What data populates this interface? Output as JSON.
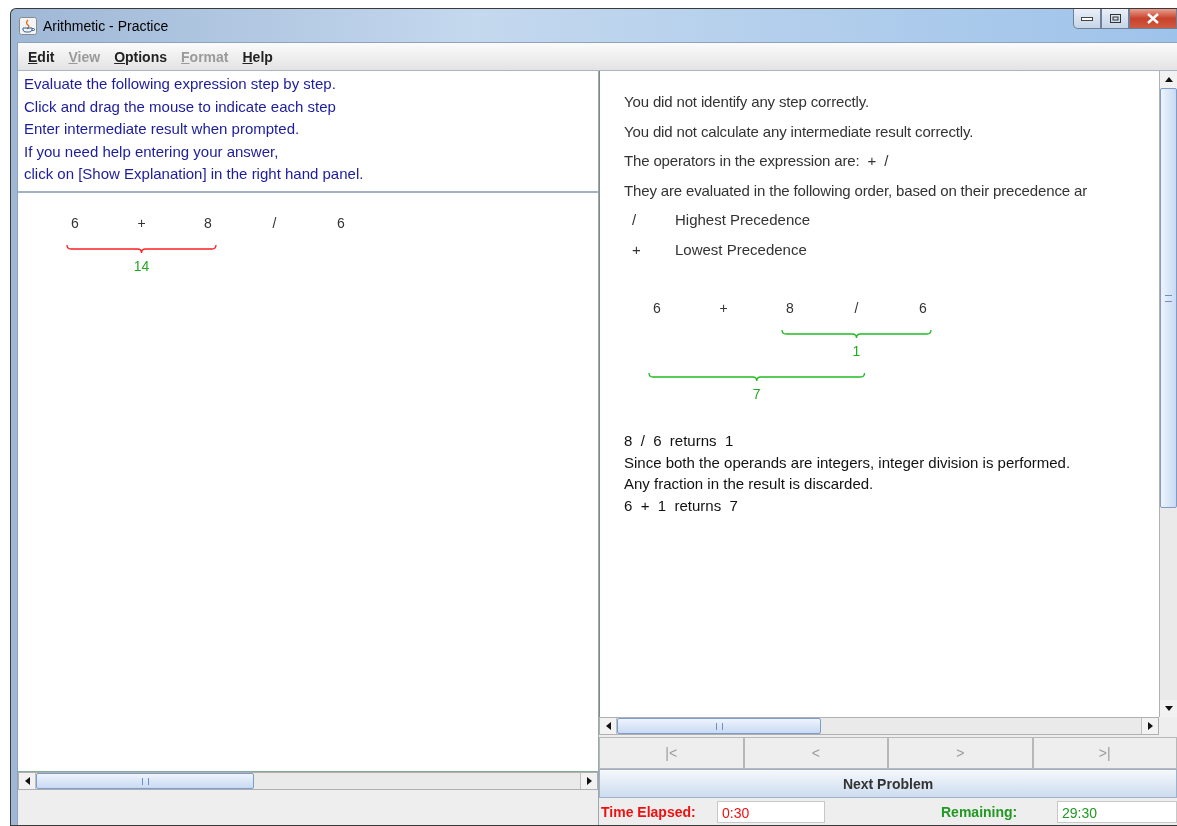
{
  "window": {
    "title": "Arithmetic - Practice"
  },
  "menu": [
    {
      "label": "Edit",
      "disabled": false
    },
    {
      "label": "View",
      "disabled": true
    },
    {
      "label": "Options",
      "disabled": false
    },
    {
      "label": "Format",
      "disabled": true
    },
    {
      "label": "Help",
      "disabled": false
    }
  ],
  "instructions": [
    "Evaluate the following expression step by step.",
    "Click and drag the mouse to indicate each step",
    "Enter intermediate result when prompted.",
    "If you need help entering your answer,",
    "click on [Show Explanation] in the right hand panel."
  ],
  "left_expression": {
    "children": [
      {
        "result": "14",
        "correct": false,
        "children": [
          {
            "token": "6"
          },
          {
            "token": "+"
          },
          {
            "token": "8"
          }
        ]
      },
      {
        "token": "/"
      },
      {
        "token": "6"
      }
    ]
  },
  "explanation": {
    "summary": [
      "You did not identify any step correctly.",
      "You did not calculate any intermediate result correctly.",
      "The operators in the expression are:  +  /",
      "They are evaluated in the following order, based on their precedence ar"
    ],
    "precedence": [
      {
        "operator": "/",
        "label": "Highest Precedence"
      },
      {
        "operator": "+",
        "label": "Lowest Precedence"
      }
    ],
    "expression": {
      "result": "7",
      "correct": true,
      "children": [
        {
          "token": "6"
        },
        {
          "token": "+"
        },
        {
          "result": "1",
          "correct": true,
          "children": [
            {
              "token": "8"
            },
            {
              "token": "/"
            },
            {
              "token": "6"
            }
          ]
        }
      ]
    },
    "steps": [
      "8  /  6  returns  1",
      "Since both the operands are integers, integer division is performed.",
      "Any fraction in the result is discarded.",
      "6  +  1  returns  7"
    ]
  },
  "navigation": [
    {
      "label": "|<",
      "disabled": true
    },
    {
      "label": "<",
      "disabled": true
    },
    {
      "label": ">",
      "disabled": true
    },
    {
      "label": ">|",
      "disabled": true
    }
  ],
  "next_button": "Next Problem",
  "timer": {
    "elapsed_label": "Time Elapsed:",
    "elapsed": "0:30",
    "remaining_label": "Remaining:",
    "remaining": "29:30"
  }
}
